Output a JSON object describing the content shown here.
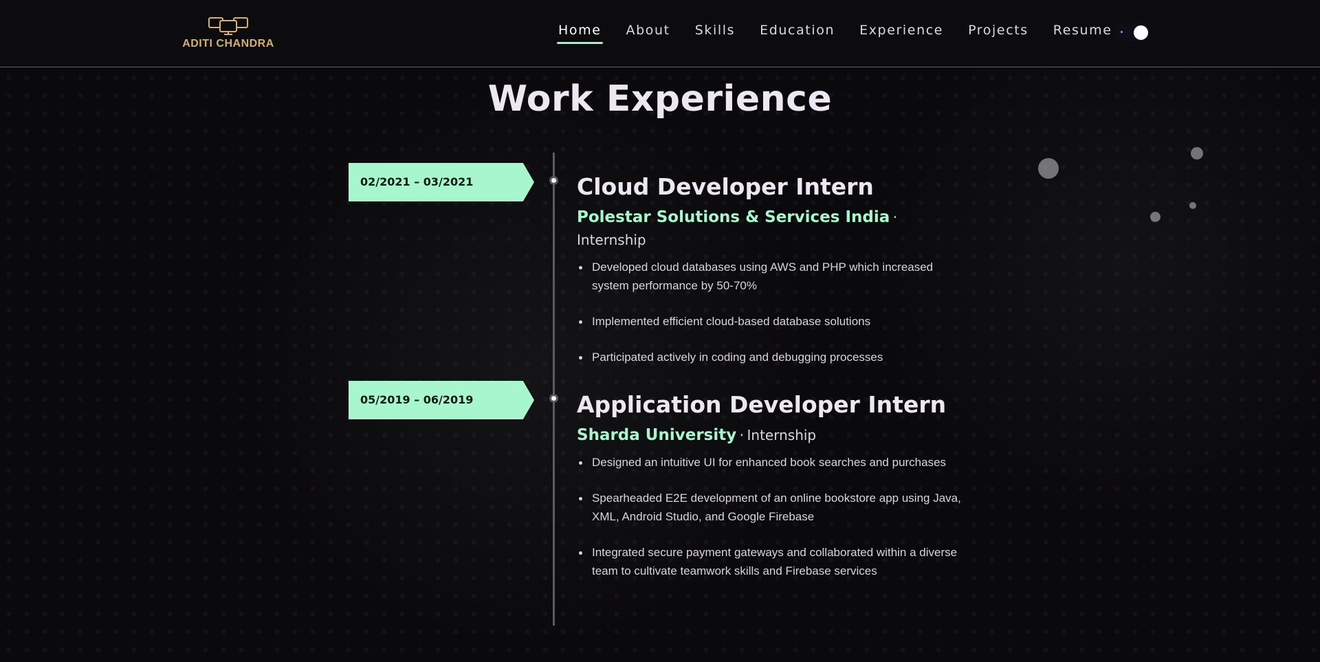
{
  "brand": {
    "name": "ADITI CHANDRA",
    "logo_icon": "three-monitors-icon",
    "color": "#d7b06a"
  },
  "nav": {
    "items": [
      {
        "label": "Home",
        "active": true
      },
      {
        "label": "About",
        "active": false
      },
      {
        "label": "Skills",
        "active": false
      },
      {
        "label": "Education",
        "active": false
      },
      {
        "label": "Experience",
        "active": false
      },
      {
        "label": "Projects",
        "active": false
      },
      {
        "label": "Resume",
        "active": false
      }
    ],
    "theme_toggle": {
      "icon": "dark-mode-toggle-icon",
      "state": "dark"
    }
  },
  "section": {
    "title": "Work Experience"
  },
  "colors": {
    "accent": "#a7f6cd",
    "background": "#0a090b",
    "title": "#ece7f1"
  },
  "experience": [
    {
      "date": "02/2021 – 03/2021",
      "title": "Cloud Developer Intern",
      "company": "Polestar Solutions & Services India",
      "separator": "·",
      "type": "Internship",
      "bullets": [
        "Developed cloud databases using AWS and PHP which increased system performance by 50-70%",
        "Implemented efficient cloud-based database solutions",
        "Participated actively in coding and debugging processes"
      ]
    },
    {
      "date": "05/2019 – 06/2019",
      "title": "Application Developer Intern",
      "company": "Sharda University",
      "separator": "·",
      "type": "Internship",
      "bullets": [
        "Designed an intuitive UI for enhanced book searches and purchases",
        "Spearheaded E2E development of an online bookstore app using Java, XML, Android Studio, and Google Firebase",
        "Integrated secure payment gateways and collaborated within a diverse team to cultivate teamwork skills and Firebase services"
      ]
    }
  ]
}
